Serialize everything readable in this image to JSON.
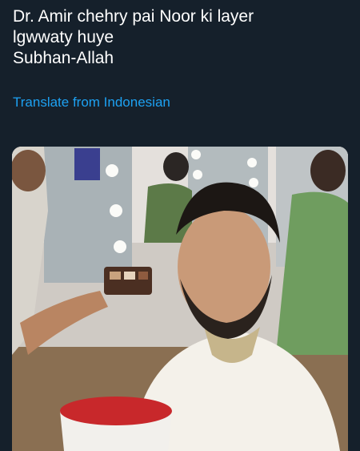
{
  "tweet": {
    "text_lines": [
      "Dr. Amir chehry pai Noor ki layer",
      "lgwwaty huye",
      "Subhan-Allah"
    ],
    "translate_label": "Translate from Indonesian"
  },
  "media": {
    "description_icon": "photo-icon",
    "colors": {
      "background": "#15202b",
      "link": "#1da1f2",
      "kurta": "#f4f1ea",
      "mug": "#c8282b"
    }
  }
}
